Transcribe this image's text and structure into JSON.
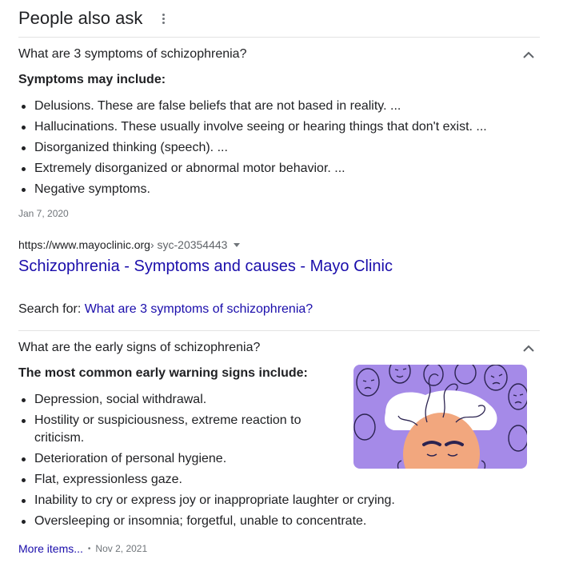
{
  "header": {
    "title": "People also ask"
  },
  "questions": [
    {
      "question": "What are 3 symptoms of schizophrenia?",
      "answer_heading": "Symptoms may include:",
      "bullets": [
        "Delusions. These are false beliefs that are not based in reality. ...",
        "Hallucinations. These usually involve seeing or hearing things that don't exist. ...",
        "Disorganized thinking (speech). ...",
        "Extremely disorganized or abnormal motor behavior. ...",
        "Negative symptoms."
      ],
      "date": "Jan 7, 2020",
      "source": {
        "domain": "https://www.mayoclinic.org",
        "path": " › syc-20354443"
      },
      "result_title": "Schizophrenia - Symptoms and causes - Mayo Clinic",
      "search_for_label": "Search for: ",
      "search_for_query": "What are 3 symptoms of schizophrenia?"
    },
    {
      "question": "What are the early signs of schizophrenia?",
      "answer_heading": "The most common early warning signs include:",
      "bullets": [
        "Depression, social withdrawal.",
        "Hostility or suspiciousness, extreme reaction to criticism.",
        "Deterioration of personal hygiene.",
        "Flat, expressionless gaze.",
        "Inability to cry or express joy or inappropriate laughter or crying.",
        "Oversleeping or insomnia; forgetful, unable to concentrate."
      ],
      "more_items": "More items...",
      "separator": "•",
      "date": "Nov 2, 2021"
    }
  ],
  "colors": {
    "link": "#1a0dab",
    "text": "#202124",
    "muted": "#70757a",
    "divider": "#e3e3e3",
    "illustration_bg": "#a58ae8"
  },
  "icons": {
    "menu": "more-vert-icon",
    "expand": "chevron-up-icon",
    "dropdown": "caret-down-icon"
  }
}
